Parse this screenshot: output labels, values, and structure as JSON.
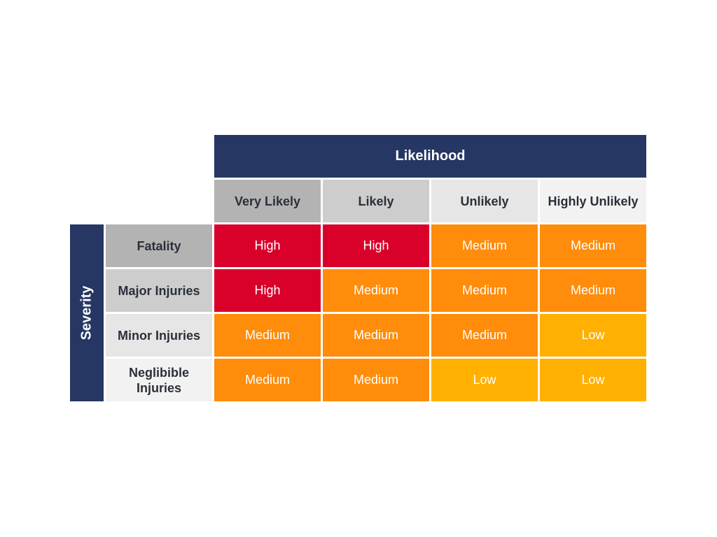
{
  "likelihood_title": "Likelihood",
  "severity_title": "Severity",
  "columns": [
    {
      "label": "Very Likely",
      "color": "#b3b3b3"
    },
    {
      "label": "Likely",
      "color": "#cdcdcd"
    },
    {
      "label": "Unlikely",
      "color": "#e6e6e6"
    },
    {
      "label": "Highly Unlikely",
      "color": "#f2f2f2"
    }
  ],
  "rows": [
    {
      "label": "Fatality",
      "color": "#b3b3b3",
      "cells": [
        "High",
        "High",
        "Medium",
        "Medium"
      ]
    },
    {
      "label": "Major Injuries",
      "color": "#cdcdcd",
      "cells": [
        "High",
        "Medium",
        "Medium",
        "Medium"
      ]
    },
    {
      "label": "Minor Injuries",
      "color": "#e6e6e6",
      "cells": [
        "Medium",
        "Medium",
        "Medium",
        "Low"
      ]
    },
    {
      "label": "Neglibible Injuries",
      "color": "#f2f2f2",
      "cells": [
        "Medium",
        "Medium",
        "Low",
        "Low"
      ]
    }
  ],
  "risk_colors": {
    "High": "#d9002a",
    "Medium": "#ff8c0a",
    "Low": "#ffb000"
  },
  "header_color": "#263764"
}
